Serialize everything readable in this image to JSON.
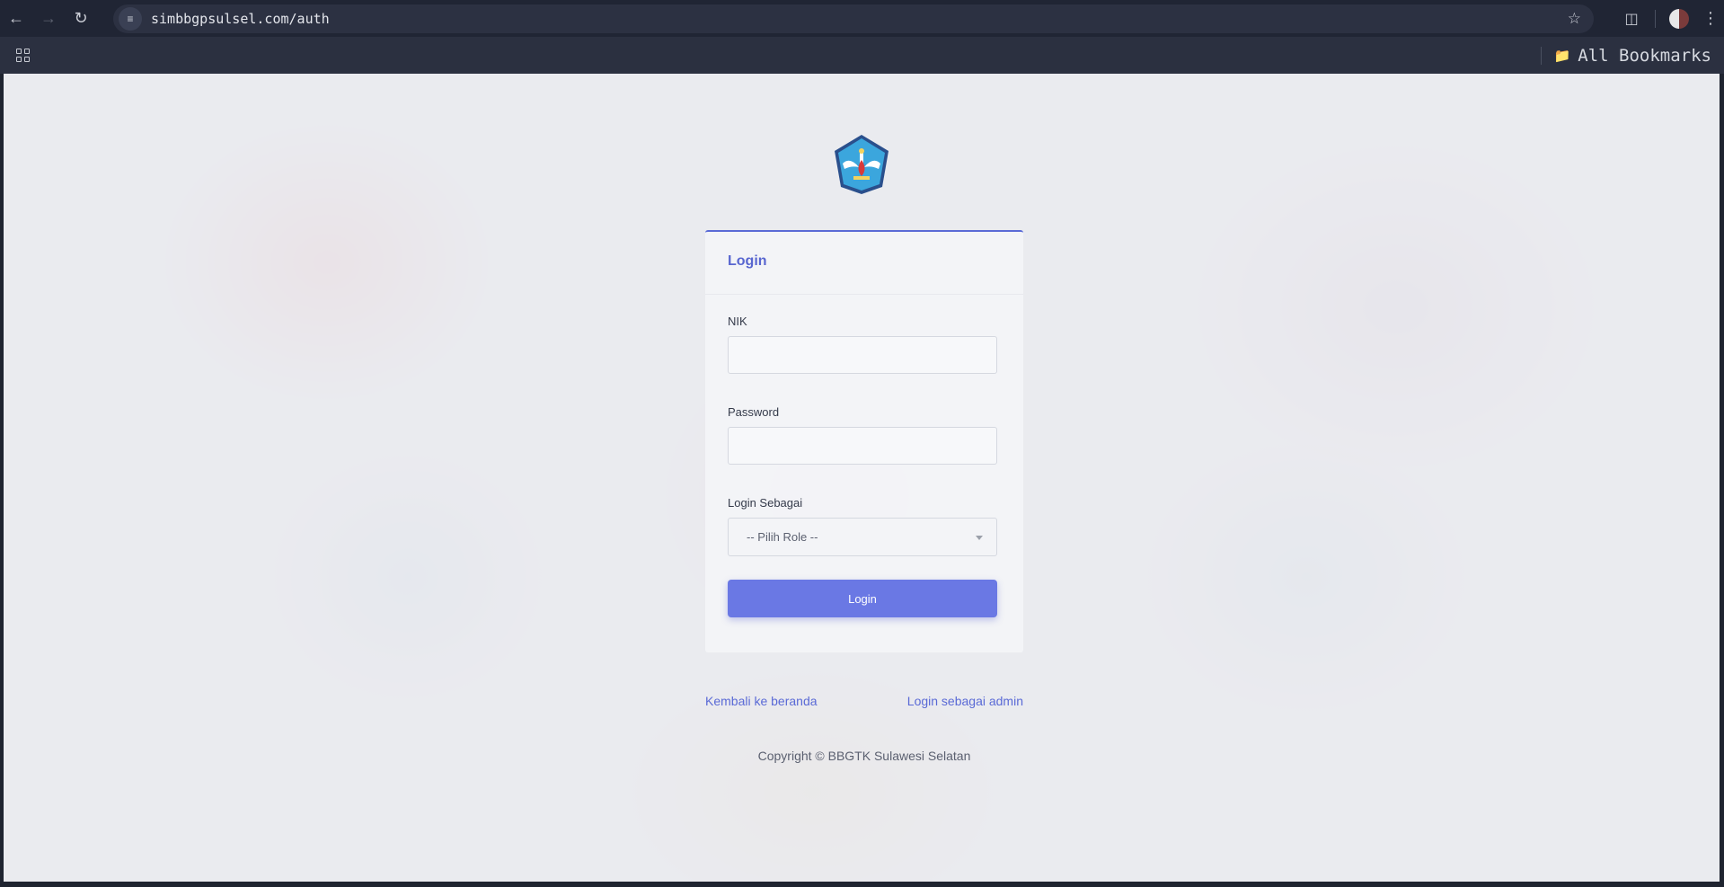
{
  "browser": {
    "url": "simbbgpsulsel.com/auth",
    "bookmarks_label": "All Bookmarks",
    "icons": {
      "back": "arrow-left-icon",
      "forward": "arrow-right-icon",
      "reload": "reload-icon",
      "site_info": "site-info-icon",
      "star": "star-icon",
      "extensions": "puzzle-icon",
      "menu": "kebab-menu-icon",
      "apps": "apps-grid-icon",
      "folder": "folder-icon"
    }
  },
  "page": {
    "logo_alt": "Tut Wuri Handayani emblem",
    "card": {
      "title": "Login",
      "nik_label": "NIK",
      "nik_value": "",
      "password_label": "Password",
      "password_value": "",
      "role_label": "Login Sebagai",
      "role_selected": "-- Pilih Role --",
      "submit_label": "Login"
    },
    "links": {
      "home": "Kembali ke beranda",
      "admin": "Login sebagai admin"
    },
    "copyright": "Copyright © BBGTK Sulawesi Selatan"
  },
  "colors": {
    "accent": "#5a6ad6",
    "button": "#6a78e4",
    "chrome": "#202534"
  }
}
